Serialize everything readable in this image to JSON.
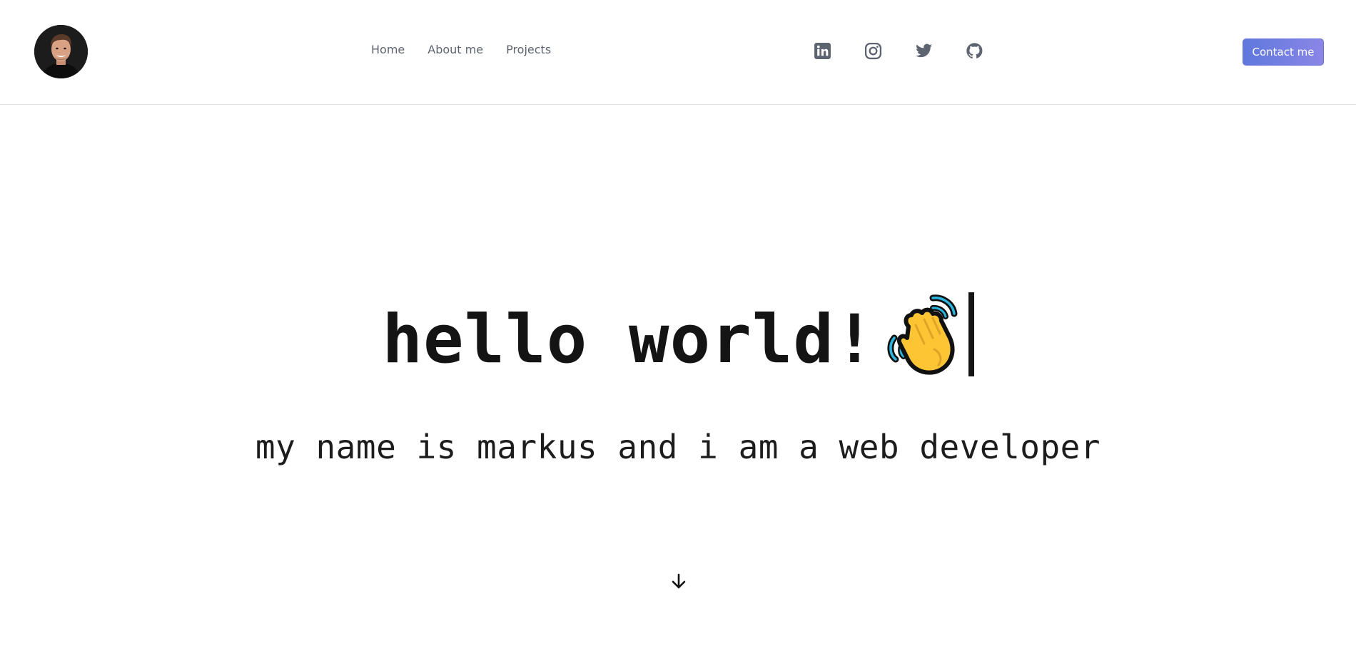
{
  "header": {
    "avatar_icon": "profile-photo",
    "nav": [
      {
        "label": "Home"
      },
      {
        "label": "About me"
      },
      {
        "label": "Projects"
      }
    ],
    "social_icons": [
      "linkedin-icon",
      "instagram-icon",
      "twitter-icon",
      "github-icon"
    ],
    "contact_label": "Contact me",
    "colors": {
      "nav_text": "#5d6470",
      "icon": "#5d6470",
      "button_start": "#5f78dd",
      "button_end": "#8a86e6"
    }
  },
  "hero": {
    "title": "hello world!",
    "title_emoji": "waving-hand-icon",
    "subtitle": "my name is markus and i am a web developer",
    "scroll_icon": "arrow-down-icon"
  }
}
